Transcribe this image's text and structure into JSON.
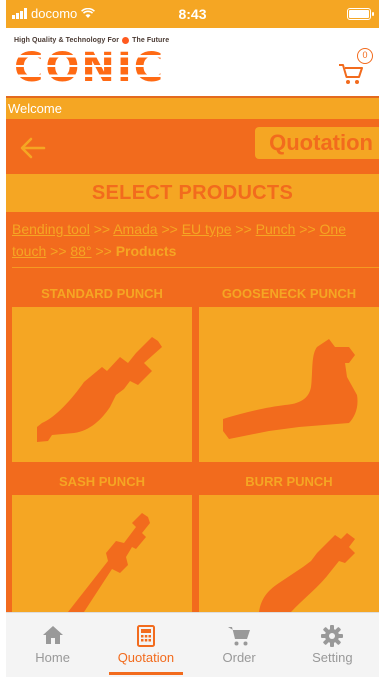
{
  "status_bar": {
    "carrier": "docomo",
    "time": "8:43"
  },
  "header": {
    "tagline_left": "High Quality & Technology For",
    "tagline_right": "The Future",
    "logo": "CONIC",
    "cart_count": "0"
  },
  "welcome": "Welcome",
  "page": {
    "badge": "Quotation",
    "title": "SELECT PRODUCTS",
    "breadcrumb": {
      "links": [
        "Bending tool",
        "Amada",
        "EU type",
        "Punch",
        "One touch",
        "88°"
      ],
      "separator": ">>",
      "current": "Products"
    }
  },
  "products": [
    {
      "label": "STANDARD PUNCH",
      "icon": "standard-punch-icon"
    },
    {
      "label": "GOOSENECK PUNCH",
      "icon": "gooseneck-punch-icon"
    },
    {
      "label": "SASH PUNCH",
      "icon": "sash-punch-icon"
    },
    {
      "label": "BURR PUNCH",
      "icon": "burr-punch-icon"
    }
  ],
  "tabs": [
    {
      "label": "Home",
      "icon": "home-icon"
    },
    {
      "label": "Quotation",
      "icon": "calculator-icon",
      "active": true
    },
    {
      "label": "Order",
      "icon": "cart-icon"
    },
    {
      "label": "Setting",
      "icon": "gear-icon"
    }
  ],
  "colors": {
    "brand_orange": "#f26b1d",
    "accent_yellow": "#f5a623",
    "tab_inactive": "#999999"
  }
}
